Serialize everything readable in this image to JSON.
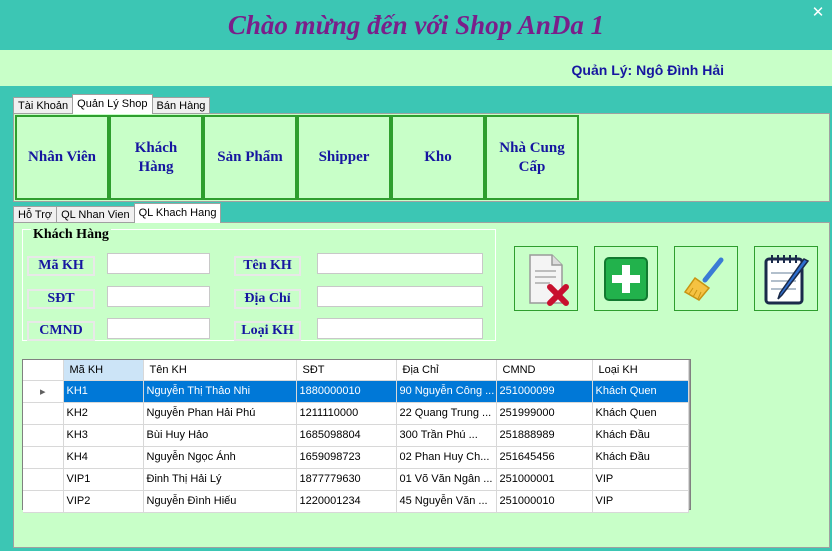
{
  "window": {
    "title": "Chào mừng đến với Shop AnDa 1",
    "close_glyph": "✕"
  },
  "manager": {
    "text": "Quản Lý: Ngô Đình Hải"
  },
  "main_tabs": [
    {
      "label": "Tài Khoản",
      "active": false
    },
    {
      "label": "Quản Lý Shop",
      "active": true
    },
    {
      "label": "Bán Hàng",
      "active": false
    }
  ],
  "nav_buttons": [
    {
      "label": "Nhân Viên"
    },
    {
      "label": "Khách\nHàng"
    },
    {
      "label": "Sản Phẩm"
    },
    {
      "label": "Shipper"
    },
    {
      "label": "Kho"
    },
    {
      "label": "Nhà Cung\nCấp"
    }
  ],
  "sub_tabs": [
    {
      "label": "Hỗ Trợ",
      "active": false
    },
    {
      "label": "QL Nhan Vien",
      "active": false
    },
    {
      "label": "QL Khach Hang",
      "active": true
    }
  ],
  "form": {
    "group_title": "Khách Hàng",
    "labels": {
      "makh": "Mã KH",
      "tenkh": "Tên KH",
      "sdt": "SĐT",
      "diachi": "Địa Chỉ",
      "cmnd": "CMND",
      "loaikh": "Loại KH"
    },
    "values": {
      "makh": "",
      "tenkh": "",
      "sdt": "",
      "diachi": "",
      "cmnd": "",
      "loaikh": ""
    }
  },
  "action_icons": [
    "delete-document-icon",
    "add-icon",
    "clear-broom-icon",
    "edit-notepad-icon"
  ],
  "colors": {
    "background": "#3cc6b4",
    "panel": "#c8ffc8",
    "title": "#7a1f8a",
    "label": "#1616a0",
    "button_border": "#2e9e2e",
    "selection": "#0078d7"
  },
  "grid": {
    "columns": [
      "Mã KH",
      "Tên KH",
      "SĐT",
      "Địa Chỉ",
      "CMND",
      "Loại KH"
    ],
    "rows": [
      [
        "KH1",
        "Nguyễn Thị Thảo Nhi",
        "1880000010",
        "90 Nguyễn Công ...",
        "251000099",
        "Khách Quen"
      ],
      [
        "KH2",
        "Nguyễn Phan Hải Phú",
        "1211110000",
        "22 Quang Trung ...",
        "251999000",
        "Khách Quen"
      ],
      [
        "KH3",
        "Bùi Huy Hảo",
        "1685098804",
        "300 Trần Phú ...",
        "251888989",
        "Khách Đầu"
      ],
      [
        "KH4",
        "Nguyễn Ngọc Ánh",
        "1659098723",
        "02 Phan Huy Ch...",
        "251645456",
        "Khách Đầu"
      ],
      [
        "VIP1",
        "Đinh Thị Hải Lý",
        "1877779630",
        "01 Võ Văn Ngân ...",
        "251000001",
        "VIP"
      ],
      [
        "VIP2",
        "Nguyễn Đình Hiếu",
        "1220001234",
        "45 Nguyễn Văn ...",
        "251000010",
        "VIP"
      ]
    ],
    "selected_row": 0,
    "row_marker": "▸"
  }
}
